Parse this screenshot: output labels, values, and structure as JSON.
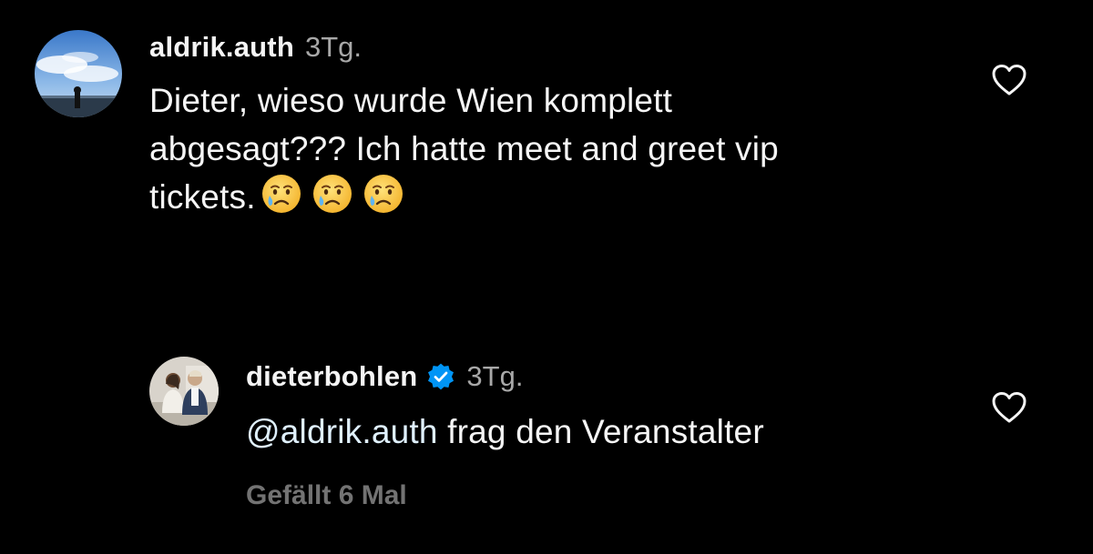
{
  "comment": {
    "username": "aldrik.auth",
    "timestamp": "3Tg.",
    "text": "Dieter, wieso wurde Wien komplett abgesagt??? Ich hatte meet and greet vip tickets.",
    "text_lines": [
      "Dieter, wieso wurde Wien komplett",
      "abgesagt??? Ich hatte meet and greet vip",
      "tickets."
    ],
    "emoji_count": 3,
    "emoji_icon": "crying-face-icon",
    "avatar_icon": "sky-sea-avatar",
    "like_icon": "heart-outline-icon"
  },
  "reply": {
    "username": "dieterbohlen",
    "verified_icon": "verified-badge-icon",
    "timestamp": "3Tg.",
    "mention": "@aldrik.auth",
    "text": " frag den Veranstalter",
    "likes": "Gefällt 6 Mal",
    "avatar_icon": "couple-photo-avatar",
    "like_icon": "heart-outline-icon"
  },
  "colors": {
    "background": "#000000",
    "text": "#f5f5f5",
    "muted": "#a8a8a8",
    "likes": "#737373",
    "verified": "#0095f6"
  }
}
